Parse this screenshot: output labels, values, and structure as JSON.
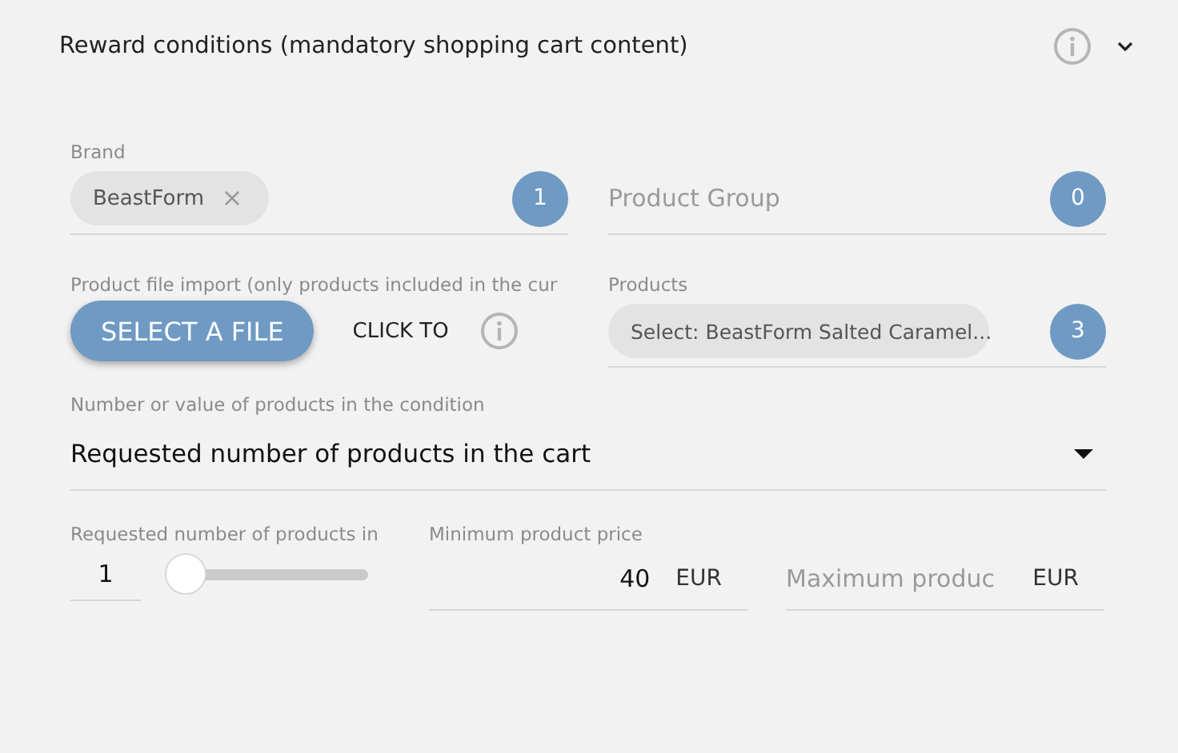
{
  "section": {
    "title": "Reward conditions (mandatory shopping cart content)",
    "expanded": true
  },
  "brand": {
    "label": "Brand",
    "chips": [
      {
        "text": "BeastForm"
      }
    ],
    "count": "1"
  },
  "product_group": {
    "placeholder": "Product Group",
    "count": "0"
  },
  "file_import": {
    "label": "Product file import (only products included in the cur",
    "button": "SELECT A FILE",
    "hint": "CLICK TO"
  },
  "products": {
    "label": "Products",
    "chips": [
      {
        "text": "Select: BeastForm Salted Caramel..."
      }
    ],
    "count": "3"
  },
  "condition": {
    "label": "Number or value of products in the condition",
    "value": "Requested number of products in the cart"
  },
  "quantity": {
    "label": "Requested number of products in",
    "value": "1",
    "level": 0
  },
  "min_price": {
    "label": "Minimum product price",
    "value": "40",
    "unit": "EUR"
  },
  "max_price": {
    "placeholder": "Maximum produc",
    "unit": "EUR"
  }
}
